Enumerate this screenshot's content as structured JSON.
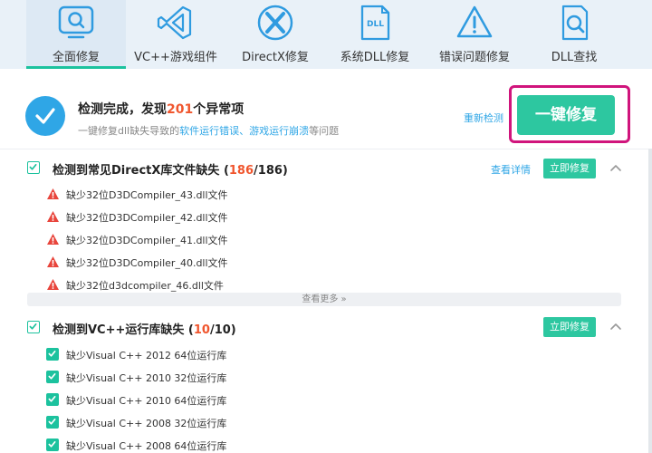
{
  "tabs": [
    {
      "label": "全面修复",
      "icon": "magnifier-screen-icon",
      "active": true
    },
    {
      "label": "VC++游戏组件",
      "icon": "visual-studio-icon",
      "active": false
    },
    {
      "label": "DirectX修复",
      "icon": "directx-icon",
      "active": false
    },
    {
      "label": "系统DLL修复",
      "icon": "dll-file-icon",
      "active": false
    },
    {
      "label": "错误问题修复",
      "icon": "warning-triangle-icon",
      "active": false
    },
    {
      "label": "DLL查找",
      "icon": "file-search-icon",
      "active": false
    }
  ],
  "status": {
    "title_prefix": "检测完成，发现",
    "count": "201",
    "title_suffix": "个异常项",
    "subtitle_prefix": "一键修复dll缺失导致的",
    "subtitle_highlight": "软件运行错误、游戏运行崩溃",
    "subtitle_suffix": "等问题",
    "rescan_label": "重新检测",
    "fix_all_label": "一键修复"
  },
  "sections": [
    {
      "title_prefix": "检测到常见DirectX库文件缺失 (",
      "found": "186",
      "total_text": "/186)",
      "detail_label": "查看详情",
      "fix_label": "立即修复",
      "items": [
        "缺少32位D3DCompiler_43.dll文件",
        "缺少32位D3DCompiler_42.dll文件",
        "缺少32位D3DCompiler_41.dll文件",
        "缺少32位D3DCompiler_40.dll文件",
        "缺少32位d3dcompiler_46.dll文件"
      ],
      "more_label": "查看更多"
    },
    {
      "title_prefix": "检测到VC++运行库缺失 (",
      "found": "10",
      "total_text": "/10)",
      "fix_label": "立即修复",
      "items": [
        "缺少Visual C++ 2012 64位运行库",
        "缺少Visual C++ 2010 32位运行库",
        "缺少Visual C++ 2010 64位运行库",
        "缺少Visual C++ 2008 32位运行库",
        "缺少Visual C++ 2008 64位运行库"
      ]
    }
  ],
  "colors": {
    "accent": "#1cc29e",
    "button": "#2dc7a0",
    "link": "#2fa6e6",
    "alert": "#f0562e",
    "highlight_frame": "#d0147c",
    "tabbar_bg": "#e9f1f8"
  }
}
